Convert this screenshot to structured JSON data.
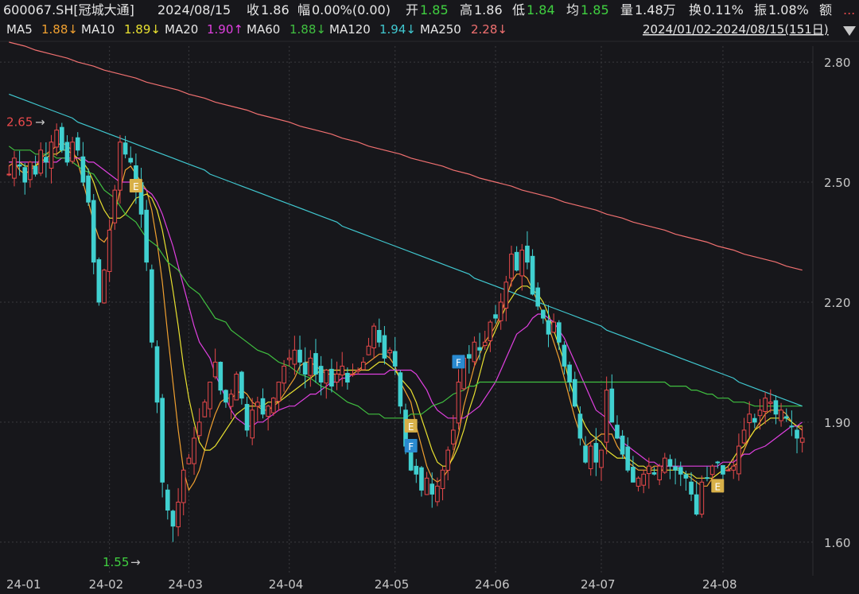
{
  "header": {
    "symbol": "600067.SH[冠城大通]",
    "date": "2024/08/15",
    "close_label": "收",
    "close": "1.86",
    "change_label": "幅",
    "change": "0.00%(0.00)",
    "open_label": "开",
    "open": "1.85",
    "high_label": "高",
    "high": "1.86",
    "low_label": "低",
    "low": "1.84",
    "avg_label": "均",
    "avg": "1.85",
    "vol_label": "量",
    "vol": "1.48万",
    "turnover_label": "换",
    "turnover": "0.11%",
    "amp_label": "振",
    "amp": "1.08%",
    "amount_label": "额",
    "more": "..."
  },
  "ma_legend": [
    {
      "name": "MA5",
      "value": "1.88↓",
      "color": "#f0a030"
    },
    {
      "name": "MA10",
      "value": "1.89↓",
      "color": "#e8e030"
    },
    {
      "name": "MA20",
      "value": "1.90↑",
      "color": "#e040e0"
    },
    {
      "name": "MA60",
      "value": "1.88↓",
      "color": "#40c040"
    },
    {
      "name": "MA120",
      "value": "1.94↓",
      "color": "#40c8d0"
    },
    {
      "name": "MA250",
      "value": "2.28↓",
      "color": "#f07070"
    }
  ],
  "range": {
    "text": "2024/01/02-2024/08/15(151日)",
    "dropdown_icon": "triangle-down-icon"
  },
  "colors": {
    "up": "#e8494b",
    "down": "#40d0d0",
    "background": "#17171b",
    "grid": "#3a3a3e",
    "axis_text": "#c8c8c8"
  },
  "chart_data": {
    "type": "candlestick",
    "ylim": [
      1.52,
      2.84
    ],
    "y_ticks": [
      "2.80",
      "2.50",
      "2.20",
      "1.90",
      "1.60"
    ],
    "x_ticks": [
      "24-01",
      "24-02",
      "24-03",
      "24-04",
      "24-05",
      "24-06",
      "24-07",
      "24-08"
    ],
    "max_label": {
      "value": "2.65",
      "arrow": "→"
    },
    "min_label": {
      "value": "1.55",
      "arrow": "→"
    },
    "markers": [
      {
        "text": "E",
        "day": 24,
        "price": 2.49,
        "color": "#d8b048"
      },
      {
        "text": "F",
        "day": 85,
        "price": 2.05,
        "color": "#2a8ad0"
      },
      {
        "text": "E",
        "day": 76,
        "price": 1.89,
        "color": "#d8b048"
      },
      {
        "text": "F",
        "day": 76,
        "price": 1.84,
        "color": "#2a8ad0"
      },
      {
        "text": "E",
        "day": 134,
        "price": 1.74,
        "color": "#d8b048"
      }
    ],
    "closes": [
      2.52,
      2.56,
      2.54,
      2.5,
      2.55,
      2.52,
      2.58,
      2.55,
      2.6,
      2.63,
      2.58,
      2.55,
      2.6,
      2.58,
      2.5,
      2.45,
      2.3,
      2.2,
      2.28,
      2.38,
      2.48,
      2.6,
      2.57,
      2.55,
      2.48,
      2.42,
      2.3,
      2.1,
      1.95,
      1.75,
      1.68,
      1.64,
      1.7,
      1.78,
      1.81,
      1.86,
      1.9,
      1.95,
      2.0,
      2.05,
      1.98,
      1.95,
      1.97,
      2.02,
      1.96,
      1.88,
      1.93,
      1.95,
      1.92,
      1.94,
      1.96,
      2.0,
      2.04,
      2.06,
      2.08,
      2.05,
      2.02,
      2.06,
      2.02,
      2.0,
      2.03,
      1.99,
      2.02,
      2.04,
      2.0,
      2.02,
      2.03,
      2.05,
      2.09,
      2.14,
      2.1,
      2.06,
      2.08,
      2.04,
      1.94,
      1.84,
      1.78,
      1.77,
      1.73,
      1.76,
      1.72,
      1.74,
      1.78,
      1.83,
      1.88,
      2.0,
      2.06,
      2.06,
      2.1,
      2.08,
      2.1,
      2.15,
      2.16,
      2.2,
      2.25,
      2.32,
      2.28,
      2.33,
      2.3,
      2.22,
      2.19,
      2.16,
      2.12,
      2.15,
      2.1,
      2.04,
      2.0,
      1.94,
      1.86,
      1.8,
      1.84,
      1.8,
      1.83,
      1.98,
      1.9,
      1.86,
      1.82,
      1.78,
      1.75,
      1.76,
      1.77,
      1.79,
      1.77,
      1.79,
      1.81,
      1.79,
      1.78,
      1.77,
      1.76,
      1.72,
      1.67,
      1.75,
      1.76,
      1.79,
      1.8,
      1.77,
      1.78,
      1.79,
      1.84,
      1.88,
      1.92,
      1.9,
      1.93,
      1.96,
      1.95,
      1.92,
      1.93,
      1.91,
      1.89,
      1.86,
      1.86
    ],
    "ma_series": [
      {
        "name": "MA5",
        "color": "#f0a030",
        "start": 0,
        "values": [
          2.54,
          2.55,
          2.53,
          2.52,
          2.53,
          2.54,
          2.56,
          2.57,
          2.58,
          2.59,
          2.6,
          2.59,
          2.58,
          2.55,
          2.5,
          2.45,
          2.4,
          2.36,
          2.35,
          2.37,
          2.42,
          2.48,
          2.53,
          2.54,
          2.52,
          2.48,
          2.43,
          2.35,
          2.25,
          2.12,
          2.0,
          1.88,
          1.78,
          1.73,
          1.75,
          1.78,
          1.83,
          1.88,
          1.92,
          1.95,
          1.96,
          1.96,
          1.97,
          1.98,
          1.97,
          1.95,
          1.94,
          1.93,
          1.93,
          1.94,
          1.95,
          1.97,
          1.99,
          2.01,
          2.04,
          2.05,
          2.05,
          2.04,
          2.03,
          2.02,
          2.02,
          2.02,
          2.02,
          2.02,
          2.02,
          2.03,
          2.04,
          2.05,
          2.06,
          2.07,
          2.07,
          2.06,
          2.04,
          2.0,
          1.95,
          1.89,
          1.84,
          1.79,
          1.76,
          1.75,
          1.76,
          1.78,
          1.82,
          1.87,
          1.94,
          1.99,
          2.04,
          2.07,
          2.1,
          2.12,
          2.14,
          2.17,
          2.21,
          2.25,
          2.27,
          2.27,
          2.26,
          2.23,
          2.2,
          2.17,
          2.14,
          2.1,
          2.06,
          2.01,
          1.96,
          1.91,
          1.87,
          1.84,
          1.85,
          1.86,
          1.87,
          1.87,
          1.87,
          1.84,
          1.82,
          1.8,
          1.79,
          1.78,
          1.78,
          1.78,
          1.79,
          1.79,
          1.79,
          1.79,
          1.78,
          1.77,
          1.76,
          1.75,
          1.74,
          1.74,
          1.76,
          1.77,
          1.78,
          1.78,
          1.79,
          1.8,
          1.83,
          1.86,
          1.88,
          1.9,
          1.92,
          1.93,
          1.93,
          1.93,
          1.92,
          1.9,
          1.89,
          1.88
        ]
      },
      {
        "name": "MA10",
        "color": "#e8e030",
        "start": 0,
        "values": [
          2.55,
          2.55,
          2.55,
          2.54,
          2.54,
          2.54,
          2.55,
          2.56,
          2.57,
          2.57,
          2.58,
          2.58,
          2.57,
          2.56,
          2.55,
          2.53,
          2.5,
          2.46,
          2.43,
          2.41,
          2.41,
          2.41,
          2.42,
          2.44,
          2.46,
          2.47,
          2.46,
          2.43,
          2.38,
          2.31,
          2.23,
          2.14,
          2.04,
          1.96,
          1.9,
          1.85,
          1.83,
          1.83,
          1.84,
          1.86,
          1.88,
          1.9,
          1.92,
          1.93,
          1.94,
          1.94,
          1.94,
          1.94,
          1.95,
          1.95,
          1.95,
          1.96,
          1.97,
          1.98,
          1.99,
          2.0,
          2.01,
          2.02,
          2.03,
          2.03,
          2.03,
          2.03,
          2.03,
          2.03,
          2.03,
          2.03,
          2.03,
          2.03,
          2.04,
          2.05,
          2.05,
          2.04,
          2.03,
          2.01,
          1.98,
          1.95,
          1.91,
          1.87,
          1.83,
          1.8,
          1.79,
          1.79,
          1.81,
          1.84,
          1.88,
          1.93,
          1.97,
          2.02,
          2.07,
          2.1,
          2.13,
          2.16,
          2.19,
          2.21,
          2.23,
          2.24,
          2.24,
          2.23,
          2.22,
          2.2,
          2.17,
          2.13,
          2.09,
          2.05,
          2.0,
          1.96,
          1.92,
          1.89,
          1.87,
          1.86,
          1.85,
          1.83,
          1.82,
          1.81,
          1.81,
          1.81,
          1.8,
          1.79,
          1.79,
          1.78,
          1.78,
          1.78,
          1.78,
          1.78,
          1.78,
          1.77,
          1.77,
          1.76,
          1.76,
          1.76,
          1.76,
          1.77,
          1.78,
          1.79,
          1.81,
          1.83,
          1.84,
          1.86,
          1.88,
          1.89,
          1.9,
          1.91,
          1.91,
          1.91,
          1.91,
          1.9,
          1.89,
          1.89
        ]
      },
      {
        "name": "MA20",
        "color": "#e040e0",
        "start": 0,
        "values": [
          2.55,
          2.55,
          2.55,
          2.55,
          2.55,
          2.55,
          2.55,
          2.55,
          2.55,
          2.56,
          2.56,
          2.56,
          2.56,
          2.56,
          2.55,
          2.55,
          2.54,
          2.53,
          2.52,
          2.51,
          2.5,
          2.5,
          2.49,
          2.49,
          2.48,
          2.47,
          2.45,
          2.42,
          2.38,
          2.34,
          2.29,
          2.24,
          2.19,
          2.14,
          2.1,
          2.06,
          2.02,
          1.99,
          1.96,
          1.93,
          1.91,
          1.9,
          1.89,
          1.89,
          1.9,
          1.9,
          1.91,
          1.92,
          1.93,
          1.94,
          1.94,
          1.95,
          1.96,
          1.97,
          1.97,
          1.98,
          1.99,
          2.0,
          2.0,
          2.01,
          2.01,
          2.02,
          2.02,
          2.02,
          2.02,
          2.02,
          2.02,
          2.03,
          2.03,
          2.03,
          2.03,
          2.03,
          2.02,
          2.0,
          1.98,
          1.95,
          1.93,
          1.91,
          1.91,
          1.91,
          1.91,
          1.92,
          1.93,
          1.94,
          1.96,
          1.98,
          2.0,
          2.03,
          2.06,
          2.09,
          2.12,
          2.14,
          2.16,
          2.17,
          2.17,
          2.16,
          2.15,
          2.13,
          2.11,
          2.08,
          2.05,
          2.02,
          1.99,
          1.96,
          1.93,
          1.91,
          1.89,
          1.87,
          1.85,
          1.84,
          1.83,
          1.82,
          1.81,
          1.8,
          1.8,
          1.79,
          1.79,
          1.79,
          1.79,
          1.79,
          1.79,
          1.79,
          1.79,
          1.79,
          1.79,
          1.79,
          1.8,
          1.8,
          1.8,
          1.81,
          1.82,
          1.82,
          1.83,
          1.84,
          1.85,
          1.86,
          1.87,
          1.88,
          1.89,
          1.89,
          1.9
        ]
      },
      {
        "name": "MA60",
        "color": "#40c040",
        "start": 0,
        "values": [
          2.59,
          2.58,
          2.58,
          2.58,
          2.57,
          2.57,
          2.57,
          2.56,
          2.56,
          2.55,
          2.54,
          2.53,
          2.52,
          2.5,
          2.48,
          2.46,
          2.44,
          2.42,
          2.4,
          2.38,
          2.36,
          2.34,
          2.32,
          2.3,
          2.28,
          2.26,
          2.24,
          2.22,
          2.2,
          2.18,
          2.16,
          2.15,
          2.13,
          2.12,
          2.1,
          2.09,
          2.08,
          2.07,
          2.06,
          2.05,
          2.04,
          2.03,
          2.02,
          2.01,
          2.0,
          1.99,
          1.98,
          1.97,
          1.96,
          1.95,
          1.94,
          1.93,
          1.92,
          1.92,
          1.91,
          1.91,
          1.91,
          1.91,
          1.92,
          1.92,
          1.93,
          1.94,
          1.95,
          1.96,
          1.97,
          1.98,
          1.99,
          1.99,
          2.0,
          2.0,
          2.0,
          2.0,
          2.0,
          2.0,
          2.0,
          2.0,
          2.0,
          2.0,
          2.0,
          2.0,
          2.0,
          2.0,
          2.0,
          2.0,
          2.0,
          2.0,
          2.0,
          2.0,
          2.0,
          2.0,
          2.0,
          2.0,
          2.0,
          2.0,
          2.0,
          1.99,
          1.99,
          1.99,
          1.98,
          1.98,
          1.97,
          1.97,
          1.96,
          1.96,
          1.95,
          1.95,
          1.95,
          1.94,
          1.94,
          1.94,
          1.94,
          1.94,
          1.94,
          1.94,
          1.94
        ]
      },
      {
        "name": "MA120",
        "color": "#40c8d0",
        "start": 0,
        "values": [
          2.72,
          2.71,
          2.7,
          2.69,
          2.68,
          2.67,
          2.66,
          2.65,
          2.64,
          2.63,
          2.62,
          2.61,
          2.6,
          2.59,
          2.58,
          2.57,
          2.56,
          2.55,
          2.54,
          2.53,
          2.52,
          2.51,
          2.5,
          2.49,
          2.48,
          2.47,
          2.46,
          2.45,
          2.44,
          2.43,
          2.42,
          2.41,
          2.4,
          2.39,
          2.38,
          2.37,
          2.36,
          2.35,
          2.34,
          2.33,
          2.32,
          2.31,
          2.3,
          2.29,
          2.28,
          2.27,
          2.26,
          2.25,
          2.24,
          2.23,
          2.22,
          2.21,
          2.2,
          2.19,
          2.18,
          2.17,
          2.16,
          2.15,
          2.14,
          2.13,
          2.12,
          2.11,
          2.1,
          2.09,
          2.08,
          2.07,
          2.06,
          2.05,
          2.04,
          2.03,
          2.02,
          2.01,
          2.0,
          1.99,
          1.98,
          1.97,
          1.96,
          1.95,
          1.94
        ]
      },
      {
        "name": "MA250",
        "color": "#f07070",
        "start": 0,
        "values": [
          2.85,
          2.84,
          2.83,
          2.82,
          2.81,
          2.8,
          2.79,
          2.78,
          2.77,
          2.76,
          2.75,
          2.74,
          2.73,
          2.72,
          2.71,
          2.7,
          2.69,
          2.68,
          2.67,
          2.66,
          2.65,
          2.64,
          2.63,
          2.62,
          2.61,
          2.6,
          2.59,
          2.58,
          2.57,
          2.56,
          2.55,
          2.54,
          2.53,
          2.52,
          2.51,
          2.5,
          2.49,
          2.48,
          2.47,
          2.46,
          2.45,
          2.44,
          2.43,
          2.42,
          2.41,
          2.4,
          2.39,
          2.38,
          2.37,
          2.36,
          2.35,
          2.34,
          2.33,
          2.32,
          2.31,
          2.3,
          2.29,
          2.28
        ]
      }
    ]
  }
}
